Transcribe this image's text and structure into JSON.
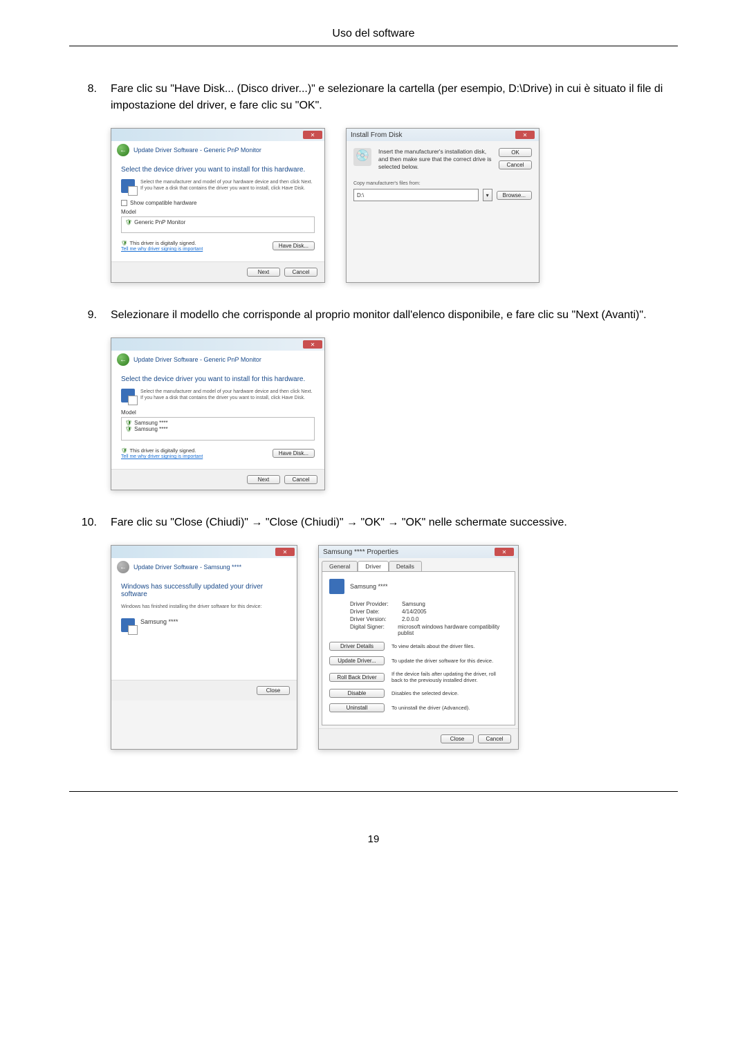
{
  "page": {
    "header": "Uso del software",
    "number": "19"
  },
  "steps": {
    "s8": {
      "num": "8.",
      "text": "Fare clic su \"Have Disk... (Disco driver...)\" e selezionare la cartella (per esempio, D:\\Drive) in cui è situato il file di impostazione del driver, e fare clic su \"OK\"."
    },
    "s9": {
      "num": "9.",
      "text": "Selezionare il modello che corrisponde al proprio monitor dall'elenco disponibile, e fare clic su \"Next (Avanti)\"."
    },
    "s10": {
      "num": "10.",
      "text": "Fare clic su \"Close (Chiudi)\" → \"Close (Chiudi)\" → \"OK\" → \"OK\" nelle schermate successive."
    }
  },
  "dlg1": {
    "nav": "Update Driver Software - Generic PnP Monitor",
    "headline": "Select the device driver you want to install for this hardware.",
    "info": "Select the manufacturer and model of your hardware device and then click Next. If you have a disk that contains the driver you want to install, click Have Disk.",
    "compat": "Show compatible hardware",
    "list_label": "Model",
    "list_item": "Generic PnP Monitor",
    "signed": "This driver is digitally signed.",
    "signed_link": "Tell me why driver signing is important",
    "have_disk": "Have Disk...",
    "next": "Next",
    "cancel": "Cancel"
  },
  "dlg2": {
    "title": "Install From Disk",
    "msg": "Insert the manufacturer's installation disk, and then make sure that the correct drive is selected below.",
    "ok": "OK",
    "cancel": "Cancel",
    "copy_label": "Copy manufacturer's files from:",
    "path": "D:\\",
    "browse": "Browse..."
  },
  "dlg3": {
    "nav": "Update Driver Software - Generic PnP Monitor",
    "headline": "Select the device driver you want to install for this hardware.",
    "info": "Select the manufacturer and model of your hardware device and then click Next. If you have a disk that contains the driver you want to install, click Have Disk.",
    "list_label": "Model",
    "item1": "Samsung ****",
    "item2": "Samsung ****",
    "signed": "This driver is digitally signed.",
    "signed_link": "Tell me why driver signing is important",
    "have_disk": "Have Disk...",
    "next": "Next",
    "cancel": "Cancel"
  },
  "dlg4": {
    "nav": "Update Driver Software - Samsung ****",
    "headline": "Windows has successfully updated your driver software",
    "sub": "Windows has finished installing the driver software for this device:",
    "device": "Samsung ****",
    "close": "Close"
  },
  "dlg5": {
    "title": "Samsung **** Properties",
    "tabs": {
      "general": "General",
      "driver": "Driver",
      "details": "Details"
    },
    "device": "Samsung ****",
    "provider_k": "Driver Provider:",
    "provider_v": "Samsung",
    "date_k": "Driver Date:",
    "date_v": "4/14/2005",
    "version_k": "Driver Version:",
    "version_v": "2.0.0.0",
    "signer_k": "Digital Signer:",
    "signer_v": "microsoft windows hardware compatibility publist",
    "btn_details": "Driver Details",
    "desc_details": "To view details about the driver files.",
    "btn_update": "Update Driver...",
    "desc_update": "To update the driver software for this device.",
    "btn_rollback": "Roll Back Driver",
    "desc_rollback": "If the device fails after updating the driver, roll back to the previously installed driver.",
    "btn_disable": "Disable",
    "desc_disable": "Disables the selected device.",
    "btn_uninstall": "Uninstall",
    "desc_uninstall": "To uninstall the driver (Advanced).",
    "close": "Close",
    "cancel": "Cancel"
  }
}
